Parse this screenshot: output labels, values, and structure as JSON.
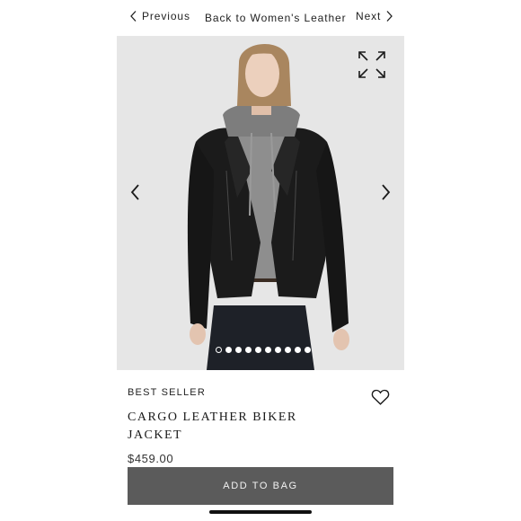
{
  "nav": {
    "previous_label": "Previous",
    "back_label": "Back to Women's Leather",
    "next_label": "Next"
  },
  "gallery": {
    "slide_count": 10,
    "active_slide": 1,
    "icons": [
      "expand-icon",
      "chevron-left-icon",
      "chevron-right-icon"
    ]
  },
  "product": {
    "badge": "BEST SELLER",
    "title": "CARGO LEATHER BIKER JACKET",
    "price": "$459.00",
    "add_to_bag_label": "ADD TO BAG",
    "wishlist_icon": "heart-outline-icon"
  },
  "colors": {
    "button_bg": "#5b5b5b",
    "gallery_bg": "#e6e6e6",
    "text": "#1a1a1a"
  }
}
